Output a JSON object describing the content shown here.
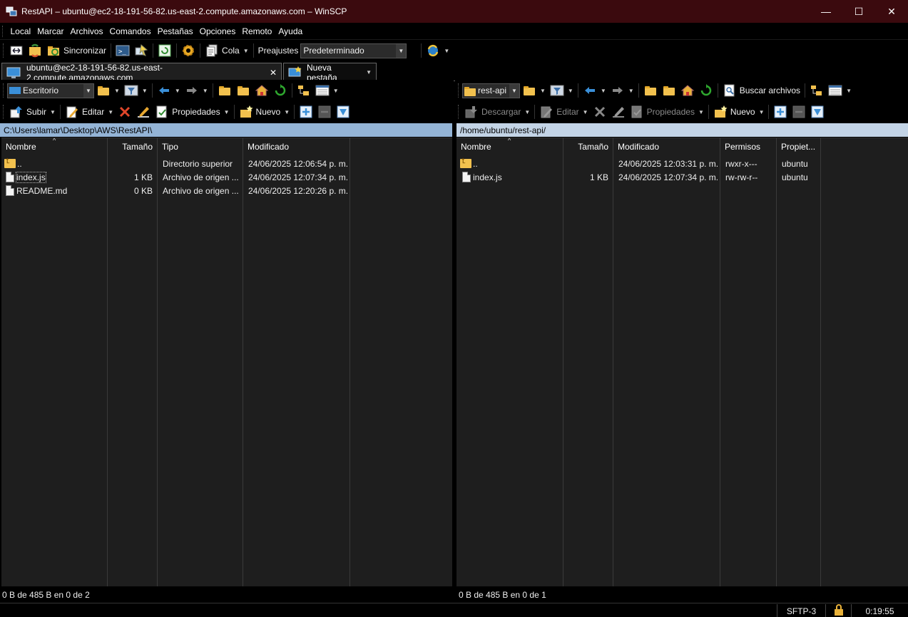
{
  "window": {
    "title": "RestAPI – ubuntu@ec2-18-191-56-82.us-east-2.compute.amazonaws.com – WinSCP",
    "minimize": "—",
    "maximize": "☐",
    "close": "✕"
  },
  "menu": [
    "Local",
    "Marcar",
    "Archivos",
    "Comandos",
    "Pestañas",
    "Opciones",
    "Remoto",
    "Ayuda"
  ],
  "toolbar": {
    "sync_label": "Sincronizar",
    "queue_label": "Cola",
    "presets_label": "Preajustes",
    "presets_value": "Predeterminado"
  },
  "tabs": {
    "session": "ubuntu@ec2-18-191-56-82.us-east-2.compute.amazonaws.com",
    "close": "✕",
    "new_tab": "Nueva pestaña"
  },
  "left": {
    "location": "Escritorio",
    "actions": {
      "upload": "Subir",
      "edit": "Editar",
      "properties": "Propiedades",
      "new": "Nuevo"
    },
    "path": "C:\\Users\\lamar\\Desktop\\AWS\\RestAPI\\",
    "columns": [
      "Nombre",
      "Tamaño",
      "Tipo",
      "Modificado"
    ],
    "rows": [
      {
        "name": "..",
        "size": "",
        "type": "Directorio superior",
        "modified": "24/06/2025 12:06:54 p. m."
      },
      {
        "name": "index.js",
        "size": "1 KB",
        "type": "Archivo de origen ...",
        "modified": "24/06/2025 12:07:34 p. m."
      },
      {
        "name": "README.md",
        "size": "0 KB",
        "type": "Archivo de origen ...",
        "modified": "24/06/2025 12:20:26 p. m."
      }
    ],
    "status": "0 B de 485 B en 0 de 2"
  },
  "right": {
    "location": "rest-api",
    "find_files": "Buscar archivos",
    "actions": {
      "download": "Descargar",
      "edit": "Editar",
      "properties": "Propiedades",
      "new": "Nuevo"
    },
    "path": "/home/ubuntu/rest-api/",
    "columns": [
      "Nombre",
      "Tamaño",
      "Modificado",
      "Permisos",
      "Propiet..."
    ],
    "rows": [
      {
        "name": "..",
        "size": "",
        "modified": "24/06/2025 12:03:31 p. m.",
        "perms": "rwxr-x---",
        "owner": "ubuntu"
      },
      {
        "name": "index.js",
        "size": "1 KB",
        "modified": "24/06/2025 12:07:34 p. m.",
        "perms": "rw-rw-r--",
        "owner": "ubuntu"
      }
    ],
    "status": "0 B de 485 B en 0 de 1"
  },
  "statusbar": {
    "protocol": "SFTP-3",
    "time": "0:19:55"
  },
  "colors": {
    "titlebar": "#3b0a0e",
    "panel_bg": "#1e1e1e",
    "left_path_bg": "#94b4d6",
    "right_path_bg": "#c3d4e6"
  }
}
